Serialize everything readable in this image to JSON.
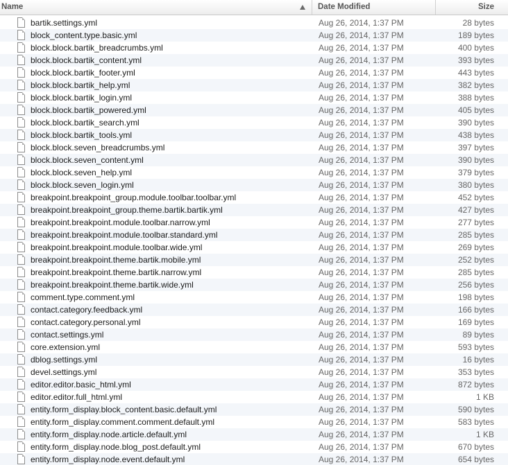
{
  "header": {
    "name_label": "Name",
    "date_label": "Date Modified",
    "size_label": "Size"
  },
  "files": [
    {
      "name": "bartik.settings.yml",
      "date": "Aug 26, 2014, 1:37 PM",
      "size": "28 bytes"
    },
    {
      "name": "block_content.type.basic.yml",
      "date": "Aug 26, 2014, 1:37 PM",
      "size": "189 bytes"
    },
    {
      "name": "block.block.bartik_breadcrumbs.yml",
      "date": "Aug 26, 2014, 1:37 PM",
      "size": "400 bytes"
    },
    {
      "name": "block.block.bartik_content.yml",
      "date": "Aug 26, 2014, 1:37 PM",
      "size": "393 bytes"
    },
    {
      "name": "block.block.bartik_footer.yml",
      "date": "Aug 26, 2014, 1:37 PM",
      "size": "443 bytes"
    },
    {
      "name": "block.block.bartik_help.yml",
      "date": "Aug 26, 2014, 1:37 PM",
      "size": "382 bytes"
    },
    {
      "name": "block.block.bartik_login.yml",
      "date": "Aug 26, 2014, 1:37 PM",
      "size": "388 bytes"
    },
    {
      "name": "block.block.bartik_powered.yml",
      "date": "Aug 26, 2014, 1:37 PM",
      "size": "405 bytes"
    },
    {
      "name": "block.block.bartik_search.yml",
      "date": "Aug 26, 2014, 1:37 PM",
      "size": "390 bytes"
    },
    {
      "name": "block.block.bartik_tools.yml",
      "date": "Aug 26, 2014, 1:37 PM",
      "size": "438 bytes"
    },
    {
      "name": "block.block.seven_breadcrumbs.yml",
      "date": "Aug 26, 2014, 1:37 PM",
      "size": "397 bytes"
    },
    {
      "name": "block.block.seven_content.yml",
      "date": "Aug 26, 2014, 1:37 PM",
      "size": "390 bytes"
    },
    {
      "name": "block.block.seven_help.yml",
      "date": "Aug 26, 2014, 1:37 PM",
      "size": "379 bytes"
    },
    {
      "name": "block.block.seven_login.yml",
      "date": "Aug 26, 2014, 1:37 PM",
      "size": "380 bytes"
    },
    {
      "name": "breakpoint.breakpoint_group.module.toolbar.toolbar.yml",
      "date": "Aug 26, 2014, 1:37 PM",
      "size": "452 bytes"
    },
    {
      "name": "breakpoint.breakpoint_group.theme.bartik.bartik.yml",
      "date": "Aug 26, 2014, 1:37 PM",
      "size": "427 bytes"
    },
    {
      "name": "breakpoint.breakpoint.module.toolbar.narrow.yml",
      "date": "Aug 26, 2014, 1:37 PM",
      "size": "277 bytes"
    },
    {
      "name": "breakpoint.breakpoint.module.toolbar.standard.yml",
      "date": "Aug 26, 2014, 1:37 PM",
      "size": "285 bytes"
    },
    {
      "name": "breakpoint.breakpoint.module.toolbar.wide.yml",
      "date": "Aug 26, 2014, 1:37 PM",
      "size": "269 bytes"
    },
    {
      "name": "breakpoint.breakpoint.theme.bartik.mobile.yml",
      "date": "Aug 26, 2014, 1:37 PM",
      "size": "252 bytes"
    },
    {
      "name": "breakpoint.breakpoint.theme.bartik.narrow.yml",
      "date": "Aug 26, 2014, 1:37 PM",
      "size": "285 bytes"
    },
    {
      "name": "breakpoint.breakpoint.theme.bartik.wide.yml",
      "date": "Aug 26, 2014, 1:37 PM",
      "size": "256 bytes"
    },
    {
      "name": "comment.type.comment.yml",
      "date": "Aug 26, 2014, 1:37 PM",
      "size": "198 bytes"
    },
    {
      "name": "contact.category.feedback.yml",
      "date": "Aug 26, 2014, 1:37 PM",
      "size": "166 bytes"
    },
    {
      "name": "contact.category.personal.yml",
      "date": "Aug 26, 2014, 1:37 PM",
      "size": "169 bytes"
    },
    {
      "name": "contact.settings.yml",
      "date": "Aug 26, 2014, 1:37 PM",
      "size": "89 bytes"
    },
    {
      "name": "core.extension.yml",
      "date": "Aug 26, 2014, 1:37 PM",
      "size": "593 bytes"
    },
    {
      "name": "dblog.settings.yml",
      "date": "Aug 26, 2014, 1:37 PM",
      "size": "16 bytes"
    },
    {
      "name": "devel.settings.yml",
      "date": "Aug 26, 2014, 1:37 PM",
      "size": "353 bytes"
    },
    {
      "name": "editor.editor.basic_html.yml",
      "date": "Aug 26, 2014, 1:37 PM",
      "size": "872 bytes"
    },
    {
      "name": "editor.editor.full_html.yml",
      "date": "Aug 26, 2014, 1:37 PM",
      "size": "1 KB"
    },
    {
      "name": "entity.form_display.block_content.basic.default.yml",
      "date": "Aug 26, 2014, 1:37 PM",
      "size": "590 bytes"
    },
    {
      "name": "entity.form_display.comment.comment.default.yml",
      "date": "Aug 26, 2014, 1:37 PM",
      "size": "583 bytes"
    },
    {
      "name": "entity.form_display.node.article.default.yml",
      "date": "Aug 26, 2014, 1:37 PM",
      "size": "1 KB"
    },
    {
      "name": "entity.form_display.node.blog_post.default.yml",
      "date": "Aug 26, 2014, 1:37 PM",
      "size": "670 bytes"
    },
    {
      "name": "entity.form_display.node.event.default.yml",
      "date": "Aug 26, 2014, 1:37 PM",
      "size": "654 bytes"
    }
  ],
  "icons": {
    "sort": "sort-ascending-icon",
    "file": "document-icon"
  }
}
